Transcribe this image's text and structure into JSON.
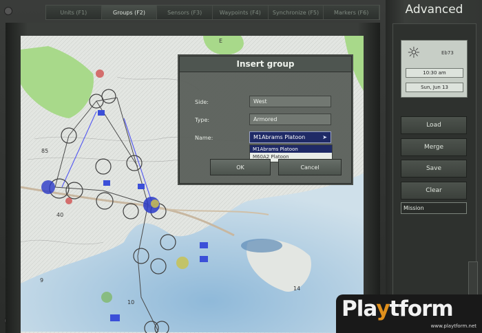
{
  "tabs": [
    {
      "label": "Units (F1)"
    },
    {
      "label": "Groups (F2)",
      "active": true
    },
    {
      "label": "Sensors (F3)"
    },
    {
      "label": "Waypoints (F4)"
    },
    {
      "label": "Synchronize (F5)"
    },
    {
      "label": "Markers (F6)"
    }
  ],
  "panel": {
    "mode_label": "Advanced",
    "weather_icon": "sun-icon",
    "weather_tag": "Eb73",
    "time": "10:30 am",
    "date": "Sun, Jun 13",
    "buttons": {
      "load": "Load",
      "merge": "Merge",
      "save": "Save",
      "clear": "Clear"
    },
    "mission_name": "Mission"
  },
  "dialog": {
    "title": "Insert group",
    "side_label": "Side:",
    "side_value": "West",
    "type_label": "Type:",
    "type_value": "Armored",
    "name_label": "Name:",
    "name_value": "M1Abrams Platoon",
    "name_options": [
      "M1Abrams Platoon",
      "M60A2 Platoon"
    ],
    "ok": "OK",
    "cancel": "Cancel"
  },
  "map": {
    "labels": [
      "E",
      "85",
      "40",
      "9",
      "10",
      "14"
    ],
    "colors": {
      "water": "#9fc4de",
      "land": "#dfe3df",
      "forest": "#9fce79",
      "route": "#5a5ef0"
    }
  },
  "watermark": {
    "logo_pre": "Pla",
    "logo_accent": "y",
    "logo_post": "tform",
    "url": "www.playtform.net"
  }
}
